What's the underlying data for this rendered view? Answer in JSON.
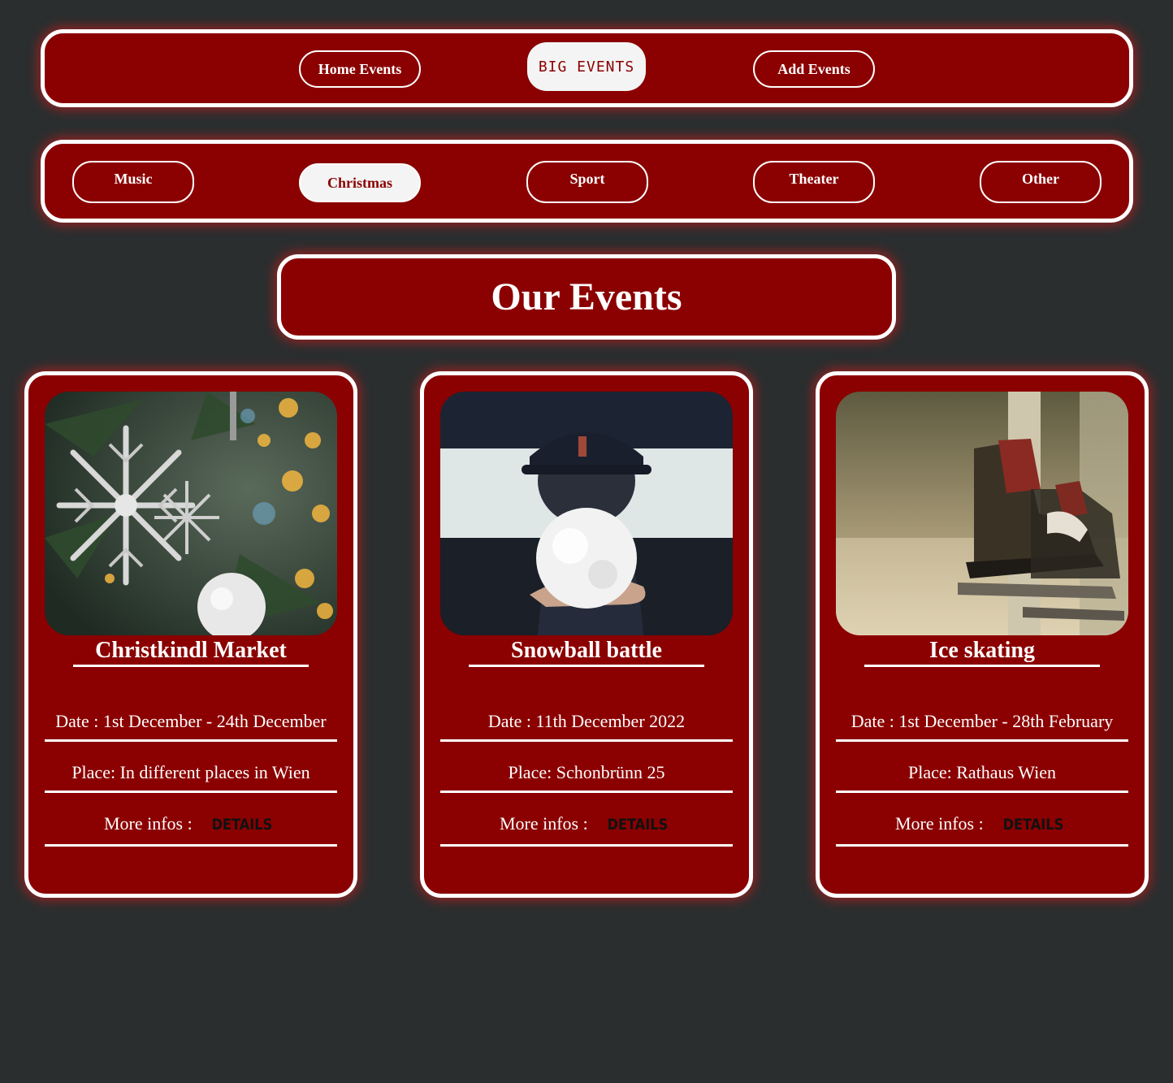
{
  "nav": {
    "home_label": "Home Events",
    "brand_label": "BIG EVENTS",
    "add_label": "Add Events"
  },
  "categories": [
    {
      "label": "Music",
      "active": false
    },
    {
      "label": "Christmas",
      "active": true
    },
    {
      "label": "Sport",
      "active": false
    },
    {
      "label": "Theater",
      "active": false
    },
    {
      "label": "Other",
      "active": false
    }
  ],
  "heading": "Our Events",
  "events": [
    {
      "title": "Christkindl Market",
      "date": "Date : 1st December - 24th December",
      "place": "Place: In different places in Wien",
      "more_label": "More infos :",
      "details_label": "DETAILS",
      "image": "christmas-ornament-image"
    },
    {
      "title": "Snowball battle",
      "date": "Date : 11th December 2022",
      "place": "Place: Schonbrünn 25",
      "more_label": "More infos :",
      "details_label": "DETAILS",
      "image": "snowball-image"
    },
    {
      "title": "Ice skating",
      "date": "Date : 1st December - 28th February",
      "place": "Place: Rathaus Wien",
      "more_label": "More infos :",
      "details_label": "DETAILS",
      "image": "ice-skates-image"
    }
  ],
  "colors": {
    "background": "#2a2e2f",
    "panel": "#8b0000",
    "border": "#ffffff",
    "active_pill": "#f4f4f4"
  }
}
